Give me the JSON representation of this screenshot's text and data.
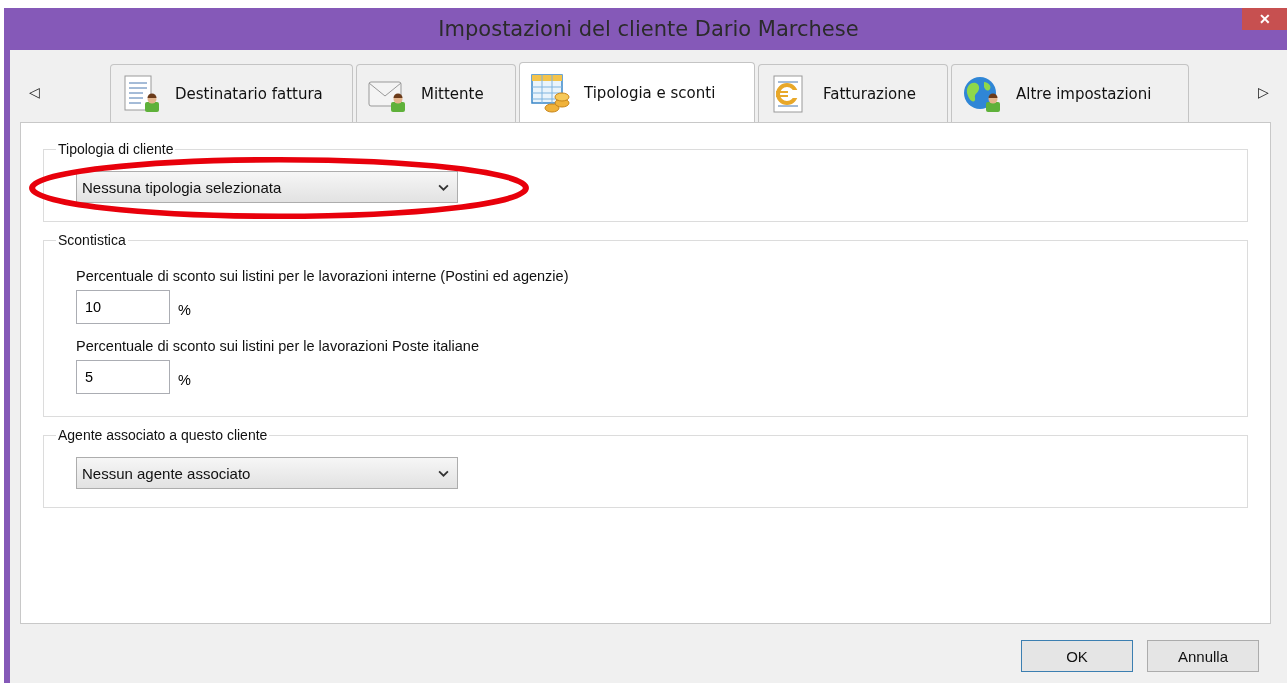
{
  "window": {
    "title": "Impostazioni del cliente Dario Marchese",
    "close": "✕"
  },
  "tab_scroll": {
    "left": "◁",
    "right": "▷"
  },
  "tabs": [
    {
      "label": "Destinatario fattura",
      "selected": false
    },
    {
      "label": "Mittente",
      "selected": false
    },
    {
      "label": "Tipologia e sconti",
      "selected": true
    },
    {
      "label": "Fatturazione",
      "selected": false
    },
    {
      "label": "Altre impostazioni",
      "selected": false
    }
  ],
  "groups": [
    {
      "kind": "dropdown",
      "legend": "Tipologia di cliente",
      "value": "Nessuna tipologia selezionata",
      "highlighted": true
    },
    {
      "kind": "percent",
      "legend": "Scontistica",
      "fields": [
        {
          "label": "Percentuale di sconto sui listini per le lavorazioni interne (Postini ed agenzie)",
          "value": "10",
          "unit": "%"
        },
        {
          "label": "Percentuale di sconto sui listini per le lavorazioni Poste italiane",
          "value": "5",
          "unit": "%"
        }
      ]
    },
    {
      "kind": "dropdown",
      "legend": "Agente associato a questo cliente",
      "value": "Nessun agente associato",
      "highlighted": false
    }
  ],
  "buttons": [
    {
      "label": "OK",
      "default": true
    },
    {
      "label": "Annulla",
      "default": false
    }
  ]
}
